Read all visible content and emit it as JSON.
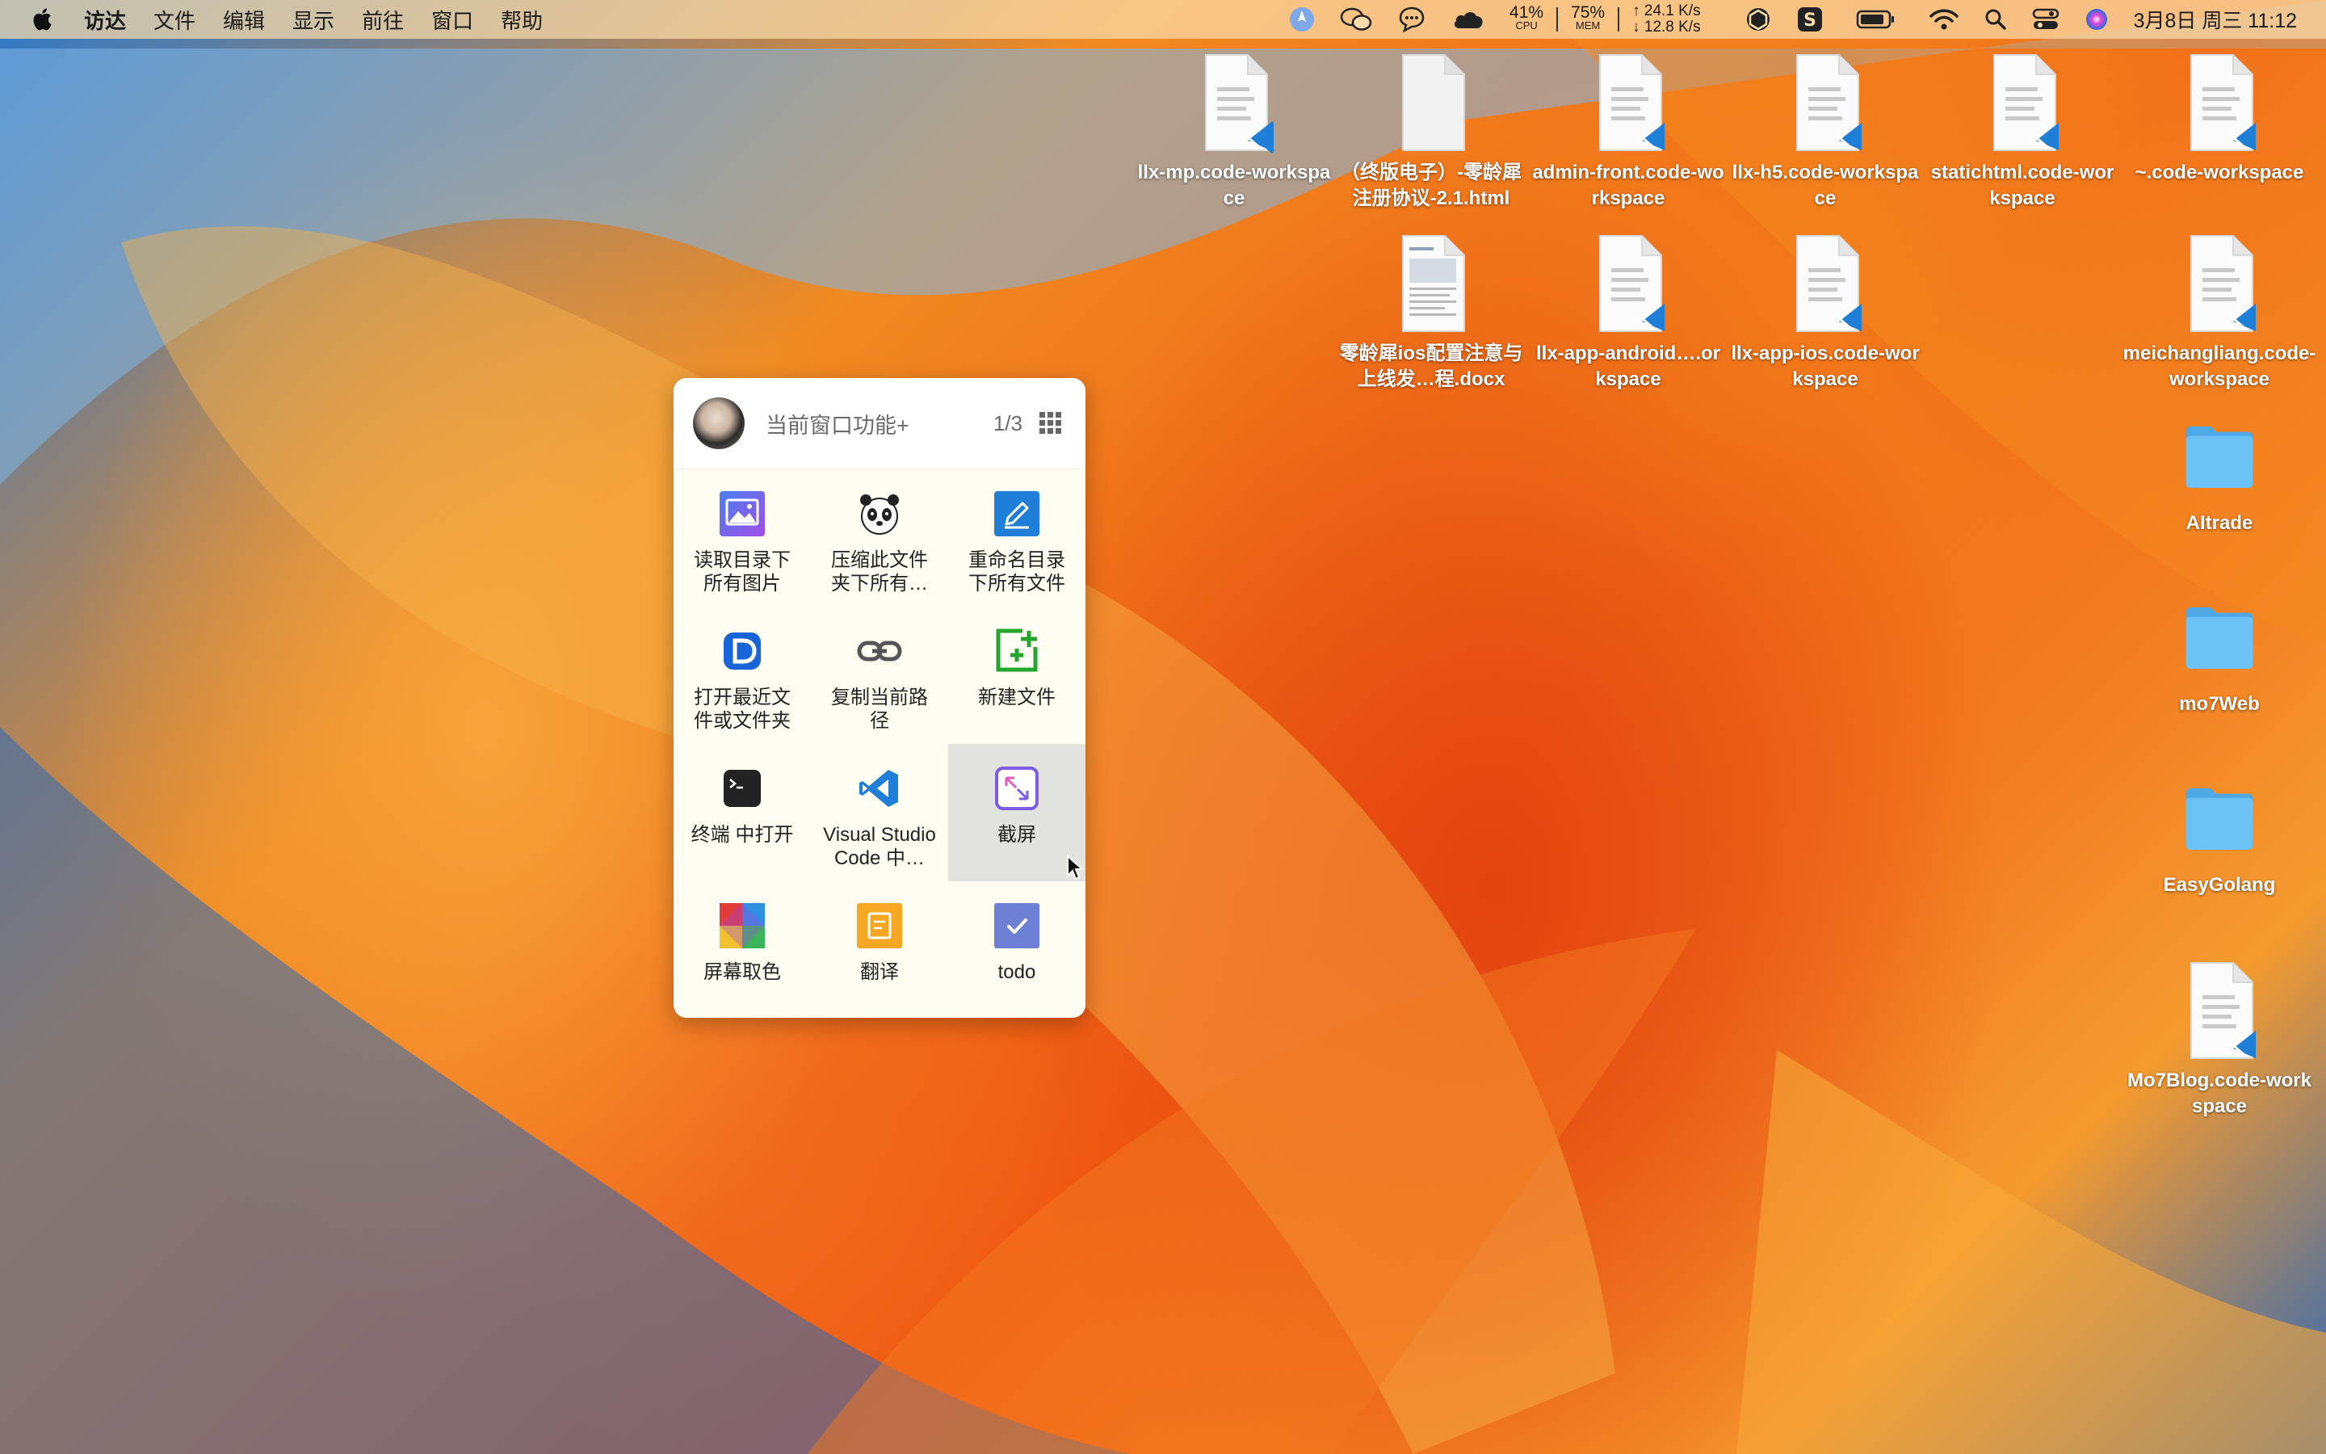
{
  "menubar": {
    "app_menu": [
      "访达",
      "文件",
      "编辑",
      "显示",
      "前往",
      "窗口",
      "帮助"
    ],
    "status": {
      "cpu_value": "41%",
      "cpu_label": "CPU",
      "mem_value": "75%",
      "mem_label": "MEM",
      "net_up": "↑ 24.1 K/s",
      "net_down": "↓ 12.8 K/s",
      "clock": "3月8日 周三  11:12"
    }
  },
  "desktop": {
    "icons": [
      {
        "label": "llx-mp.code-workspace",
        "type": "vscode-file"
      },
      {
        "label": "（终版电子）-零龄犀注册协议-2.1.html",
        "type": "blank-file"
      },
      {
        "label": "admin-front.code-workspace",
        "type": "vscode-file"
      },
      {
        "label": "llx-h5.code-workspace",
        "type": "vscode-file"
      },
      {
        "label": "statichtml.code-workspace",
        "type": "vscode-file"
      },
      {
        "label": "~.code-workspace",
        "type": "vscode-file"
      },
      {
        "label": "零龄犀ios配置注意与上线发…程.docx",
        "type": "doc-file"
      },
      {
        "label": "llx-app-android….orkspace",
        "type": "vscode-file"
      },
      {
        "label": "llx-app-ios.code-workspace",
        "type": "vscode-file"
      },
      {
        "label": "meichangliang.code-workspace",
        "type": "vscode-file"
      },
      {
        "label": "AItrade",
        "type": "folder"
      },
      {
        "label": "mo7Web",
        "type": "folder"
      },
      {
        "label": "EasyGolang",
        "type": "folder"
      },
      {
        "label": "Mo7Blog.code-workspace",
        "type": "vscode-file"
      }
    ]
  },
  "panel": {
    "title": "当前窗口功能+",
    "page_indicator": "1/3",
    "items": [
      {
        "label": "读取目录下所有图片",
        "icon": "image-gallery-icon"
      },
      {
        "label": "压缩此文件夹下所有…",
        "icon": "panda-icon"
      },
      {
        "label": "重命名目录下所有文件",
        "icon": "pencil-edit-icon"
      },
      {
        "label": "打开最近文件或文件夹",
        "icon": "recent-d-icon"
      },
      {
        "label": "复制当前路径",
        "icon": "link-icon"
      },
      {
        "label": "新建文件",
        "icon": "new-file-plus-icon"
      },
      {
        "label": "终端 中打开",
        "icon": "terminal-icon"
      },
      {
        "label": "Visual Studio Code 中…",
        "icon": "vscode-icon"
      },
      {
        "label": "截屏",
        "icon": "screenshot-icon"
      },
      {
        "label": "屏幕取色",
        "icon": "color-picker-icon"
      },
      {
        "label": "翻译",
        "icon": "translate-icon"
      },
      {
        "label": "todo",
        "icon": "todo-check-icon"
      }
    ]
  },
  "colors": {
    "vscode_blue": "#1f7fd6",
    "folder_blue": "#5bb7f0",
    "panel_bg": "#fffdf2"
  }
}
